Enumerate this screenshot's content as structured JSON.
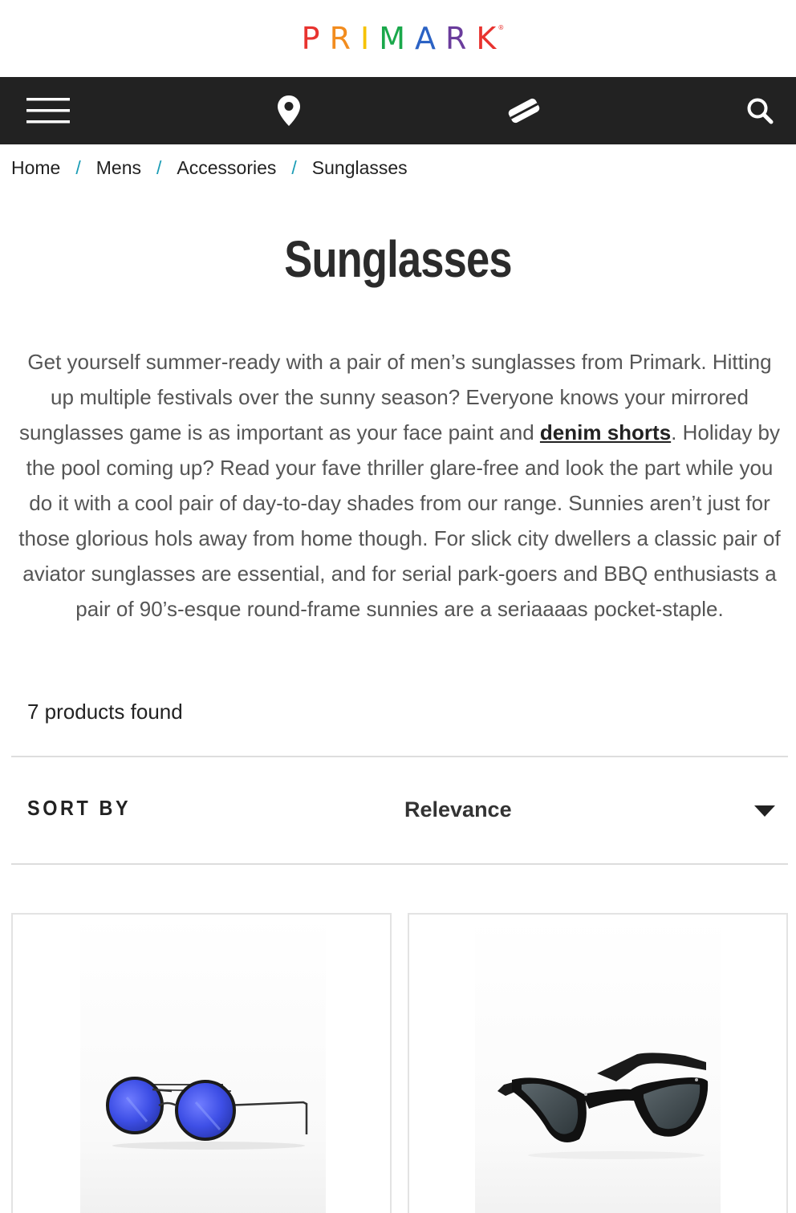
{
  "brand": {
    "logo_letters": [
      "P",
      "R",
      "I",
      "M",
      "A",
      "R",
      "K"
    ],
    "logo_colors": [
      "#e8332f",
      "#f28c1e",
      "#f6c200",
      "#1aa84b",
      "#2b62c4",
      "#6a3c9c",
      "#e8332f"
    ],
    "registered_mark": "®"
  },
  "nav": {
    "menu_icon": "hamburger-menu-icon",
    "stores_icon": "location-pin-icon",
    "gift_card_icon": "gift-card-icon",
    "search_icon": "search-icon",
    "background": "#222222"
  },
  "breadcrumb": {
    "items": [
      "Home",
      "Mens",
      "Accessories",
      "Sunglasses"
    ],
    "separator": "/",
    "separator_color": "#1a9cb5"
  },
  "page": {
    "title": "Sunglasses",
    "description": {
      "part1": "Get yourself summer-ready with a pair of men’s sunglasses from Primark. Hitting up multiple festivals over the sunny season? Everyone knows your mirrored sunglasses game is as important as your face paint and ",
      "link": "denim shorts",
      "part2": ". Holiday by the pool coming up? Read your fave thriller glare-free and look the part while you do it with a cool pair of day-to-day shades from our range. Sunnies aren’t just for those glorious hols away from home though. For slick city dwellers a classic pair of aviator sunglasses are essential, and for serial park-goers and BBQ enthusiasts a pair of 90’s-esque round-frame sunnies are a seriaaaas pocket-staple."
    },
    "products_found": "7 products found"
  },
  "sort": {
    "label": "SORT BY",
    "selected": "Relevance"
  },
  "products": [
    {
      "image": "round-blue-mirrored-sunglasses"
    },
    {
      "image": "black-wayfarer-sunglasses"
    }
  ]
}
